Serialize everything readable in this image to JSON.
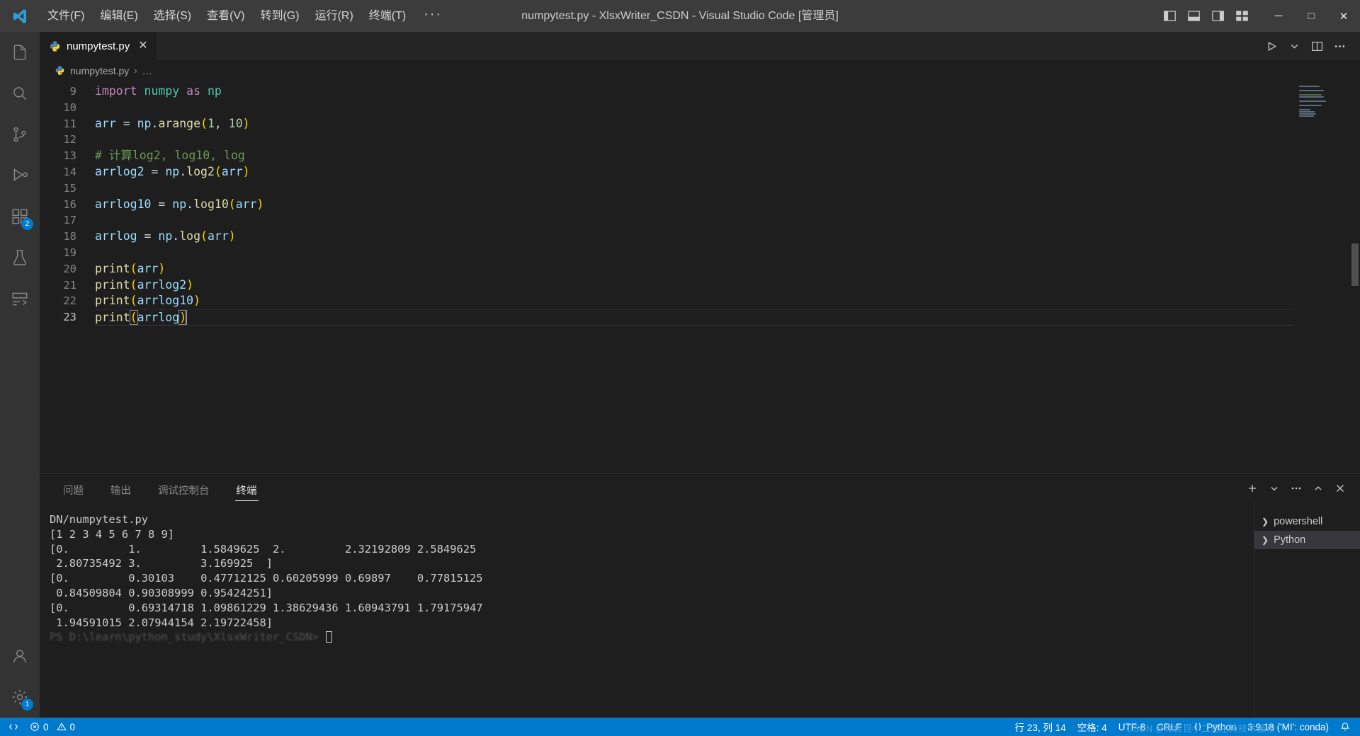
{
  "titlebar": {
    "logo_icon": "vscode-logo-icon",
    "menus": [
      {
        "label": "文件(F)"
      },
      {
        "label": "编辑(E)"
      },
      {
        "label": "选择(S)"
      },
      {
        "label": "查看(V)"
      },
      {
        "label": "转到(G)"
      },
      {
        "label": "运行(R)"
      },
      {
        "label": "终端(T)"
      }
    ],
    "more_label": "···",
    "title": "numpytest.py - XlsxWriter_CSDN - Visual Studio Code [管理员]",
    "layout_icons": [
      "toggle-primary-sidebar-icon",
      "toggle-panel-icon",
      "toggle-secondary-sidebar-icon",
      "customize-layout-icon"
    ],
    "window_buttons": {
      "minimize": "─",
      "maximize": "□",
      "close": "✕"
    }
  },
  "activitybar": {
    "items": [
      {
        "name": "explorer",
        "icon": "files-icon",
        "active": false,
        "badge": ""
      },
      {
        "name": "search",
        "icon": "search-icon",
        "active": false,
        "badge": ""
      },
      {
        "name": "source-control",
        "icon": "source-control-icon",
        "active": false,
        "badge": ""
      },
      {
        "name": "run-and-debug",
        "icon": "run-debug-icon",
        "active": false,
        "badge": ""
      },
      {
        "name": "extensions",
        "icon": "extensions-icon",
        "active": false,
        "badge": "2"
      },
      {
        "name": "testing",
        "icon": "beaker-icon",
        "active": false,
        "badge": ""
      },
      {
        "name": "remote-explorer",
        "icon": "remote-explorer-icon",
        "active": false,
        "badge": ""
      }
    ],
    "bottom_items": [
      {
        "name": "accounts",
        "icon": "account-icon",
        "badge": ""
      },
      {
        "name": "settings",
        "icon": "gear-icon",
        "badge": "1"
      }
    ]
  },
  "editor": {
    "tab": {
      "label": "numpytest.py",
      "icon": "python-file-icon",
      "close_icon": "✕"
    },
    "tab_actions": [
      "run-python-file-icon",
      "chevron-down-icon",
      "split-editor-icon",
      "more-actions-icon"
    ],
    "breadcrumb": {
      "file": "numpytest.py",
      "separator": "›",
      "ellipsis": "…",
      "icon": "python-file-icon"
    },
    "first_line_number": 9,
    "lines": [
      {
        "n": 9,
        "tokens": [
          {
            "t": "import",
            "c": "k-import"
          },
          {
            "t": " ",
            "c": "k-op"
          },
          {
            "t": "numpy",
            "c": "k-mod"
          },
          {
            "t": " ",
            "c": "k-op"
          },
          {
            "t": "as",
            "c": "k-import"
          },
          {
            "t": " ",
            "c": "k-op"
          },
          {
            "t": "np",
            "c": "k-mod"
          }
        ]
      },
      {
        "n": 10,
        "tokens": []
      },
      {
        "n": 11,
        "tokens": [
          {
            "t": "arr",
            "c": "k-var"
          },
          {
            "t": " = ",
            "c": "k-op"
          },
          {
            "t": "np",
            "c": "k-var"
          },
          {
            "t": ".",
            "c": "k-op"
          },
          {
            "t": "arange",
            "c": "k-fn"
          },
          {
            "t": "(",
            "c": "k-paren"
          },
          {
            "t": "1",
            "c": "k-num"
          },
          {
            "t": ", ",
            "c": "k-op"
          },
          {
            "t": "10",
            "c": "k-num"
          },
          {
            "t": ")",
            "c": "k-paren"
          }
        ]
      },
      {
        "n": 12,
        "tokens": []
      },
      {
        "n": 13,
        "tokens": [
          {
            "t": "# 计算log2, log10, log",
            "c": "k-cmt"
          }
        ]
      },
      {
        "n": 14,
        "tokens": [
          {
            "t": "arrlog2",
            "c": "k-var"
          },
          {
            "t": " = ",
            "c": "k-op"
          },
          {
            "t": "np",
            "c": "k-var"
          },
          {
            "t": ".",
            "c": "k-op"
          },
          {
            "t": "log2",
            "c": "k-fn"
          },
          {
            "t": "(",
            "c": "k-paren"
          },
          {
            "t": "arr",
            "c": "k-var"
          },
          {
            "t": ")",
            "c": "k-paren"
          }
        ]
      },
      {
        "n": 15,
        "tokens": []
      },
      {
        "n": 16,
        "tokens": [
          {
            "t": "arrlog10",
            "c": "k-var"
          },
          {
            "t": " = ",
            "c": "k-op"
          },
          {
            "t": "np",
            "c": "k-var"
          },
          {
            "t": ".",
            "c": "k-op"
          },
          {
            "t": "log10",
            "c": "k-fn"
          },
          {
            "t": "(",
            "c": "k-paren"
          },
          {
            "t": "arr",
            "c": "k-var"
          },
          {
            "t": ")",
            "c": "k-paren"
          }
        ]
      },
      {
        "n": 17,
        "tokens": []
      },
      {
        "n": 18,
        "tokens": [
          {
            "t": "arrlog",
            "c": "k-var"
          },
          {
            "t": " = ",
            "c": "k-op"
          },
          {
            "t": "np",
            "c": "k-var"
          },
          {
            "t": ".",
            "c": "k-op"
          },
          {
            "t": "log",
            "c": "k-fn"
          },
          {
            "t": "(",
            "c": "k-paren"
          },
          {
            "t": "arr",
            "c": "k-var"
          },
          {
            "t": ")",
            "c": "k-paren"
          }
        ]
      },
      {
        "n": 19,
        "tokens": []
      },
      {
        "n": 20,
        "tokens": [
          {
            "t": "print",
            "c": "k-fn"
          },
          {
            "t": "(",
            "c": "k-paren"
          },
          {
            "t": "arr",
            "c": "k-var"
          },
          {
            "t": ")",
            "c": "k-paren"
          }
        ]
      },
      {
        "n": 21,
        "tokens": [
          {
            "t": "print",
            "c": "k-fn"
          },
          {
            "t": "(",
            "c": "k-paren"
          },
          {
            "t": "arrlog2",
            "c": "k-var"
          },
          {
            "t": ")",
            "c": "k-paren"
          }
        ]
      },
      {
        "n": 22,
        "tokens": [
          {
            "t": "print",
            "c": "k-fn"
          },
          {
            "t": "(",
            "c": "k-paren"
          },
          {
            "t": "arrlog10",
            "c": "k-var"
          },
          {
            "t": ")",
            "c": "k-paren"
          }
        ]
      },
      {
        "n": 23,
        "current": true,
        "tokens": [
          {
            "t": "print",
            "c": "k-fn"
          },
          {
            "t": "(",
            "c": "k-paren",
            "box": true
          },
          {
            "t": "arrlog",
            "c": "k-var"
          },
          {
            "t": ")",
            "c": "k-paren",
            "box": true
          },
          {
            "t": "|",
            "c": "cursor"
          }
        ]
      }
    ]
  },
  "panel": {
    "tabs": [
      {
        "label": "问题",
        "active": false
      },
      {
        "label": "输出",
        "active": false
      },
      {
        "label": "调试控制台",
        "active": false
      },
      {
        "label": "终端",
        "active": true
      }
    ],
    "actions": [
      "new-terminal-icon",
      "chevron-down-icon",
      "more-actions-icon",
      "maximize-panel-icon",
      "close-panel-icon"
    ],
    "terminal_lines": [
      "DN/numpytest.py",
      "[1 2 3 4 5 6 7 8 9]",
      "[0.         1.         1.5849625  2.         2.32192809 2.5849625",
      " 2.80735492 3.         3.169925  ]",
      "[0.         0.30103    0.47712125 0.60205999 0.69897    0.77815125",
      " 0.84509804 0.90308999 0.95424251]",
      "[0.         0.69314718 1.09861229 1.38629436 1.60943791 1.79175947",
      " 1.94591015 2.07944154 2.19722458]"
    ],
    "terminal_blurred_line": "PS D:\\learn\\python_study\\XlsxWriter_CSDN>",
    "terminal_cursor": "█",
    "terminal_list": [
      {
        "label": "powershell",
        "active": false,
        "icon": "chevron-right-icon"
      },
      {
        "label": "Python",
        "active": true,
        "icon": "chevron-right-icon"
      }
    ]
  },
  "statusbar": {
    "left": [
      {
        "name": "remote-indicator",
        "label": "",
        "icon": "remote-icon"
      },
      {
        "name": "problems",
        "label": "0",
        "icon": "error-icon",
        "label2": "0",
        "icon2": "warning-icon"
      }
    ],
    "errors": "0",
    "warnings": "0",
    "right": [
      {
        "name": "cursor-position",
        "label": "行 23, 列 14"
      },
      {
        "name": "indentation",
        "label": "空格: 4"
      },
      {
        "name": "encoding",
        "label": "UTF-8"
      },
      {
        "name": "eol",
        "label": "CRLF"
      },
      {
        "name": "language-mode",
        "label": "Python",
        "icon": "braces-icon"
      },
      {
        "name": "python-interpreter",
        "label": "3.9.18 ('MI': conda)"
      },
      {
        "name": "bell",
        "label": "",
        "icon": "bell-icon"
      }
    ],
    "watermark": "CSDN @你佳昆小二哥主持技术量和"
  },
  "colors": {
    "accent": "#007acc",
    "titlebar_bg": "#3c3c3c",
    "activitybar_bg": "#333333",
    "editor_bg": "#1e1e1e",
    "tabbar_bg": "#252526",
    "badge_bg": "#007acc"
  }
}
